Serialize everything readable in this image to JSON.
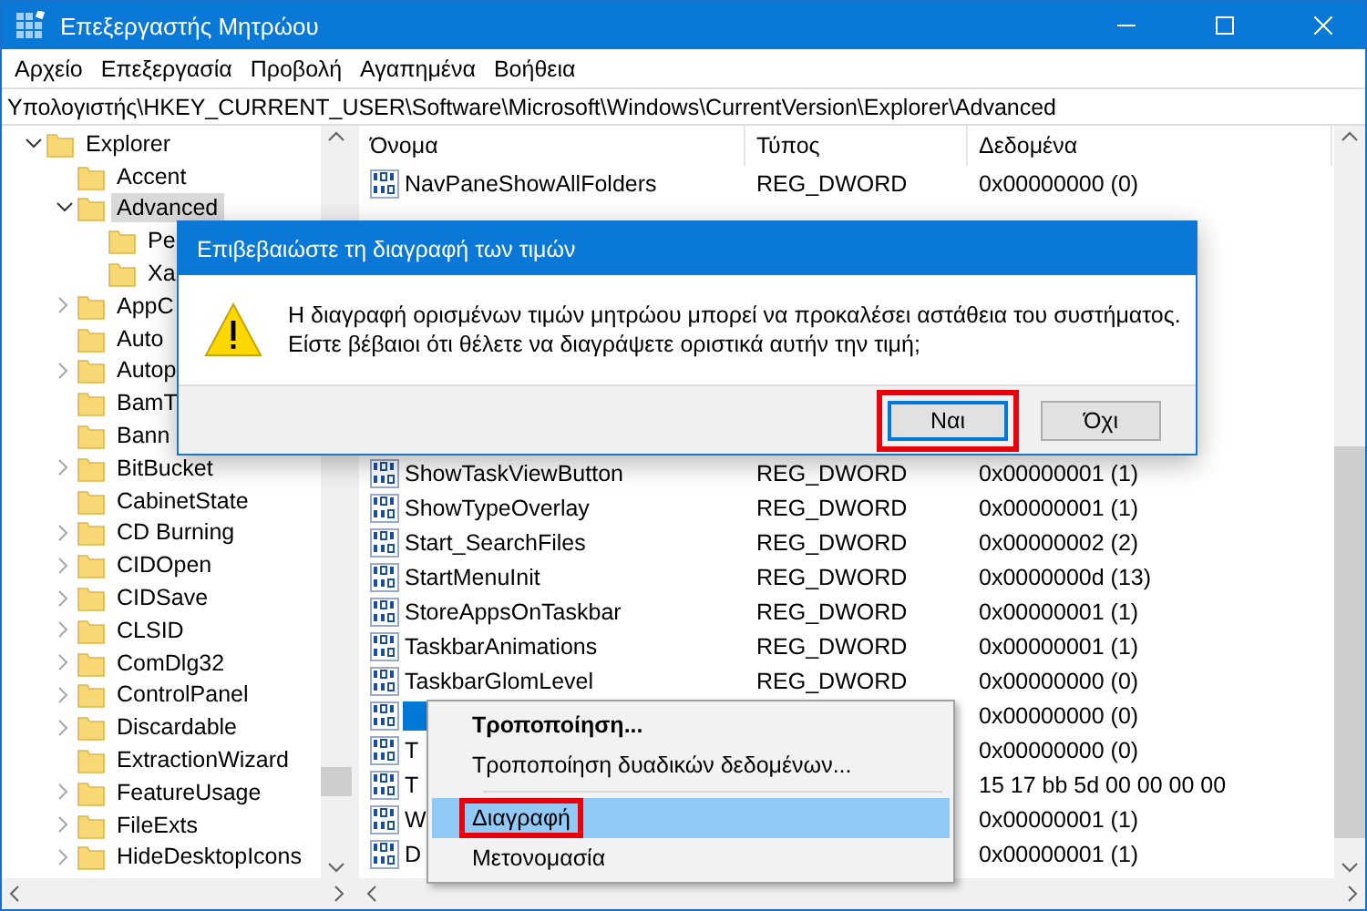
{
  "window": {
    "title": "Επεξεργαστής Μητρώου"
  },
  "menu": [
    "Αρχείο",
    "Επεξεργασία",
    "Προβολή",
    "Αγαπημένα",
    "Βοήθεια"
  ],
  "address": "Υπολογιστής\\HKEY_CURRENT_USER\\Software\\Microsoft\\Windows\\CurrentVersion\\Explorer\\Advanced",
  "tree": [
    {
      "label": "Explorer",
      "expanded": true,
      "selected": false,
      "children": [
        {
          "label": "Accent",
          "expanded": false,
          "selected": false
        },
        {
          "label": "Advanced",
          "expanded": true,
          "selected": true,
          "children": [
            {
              "label": "Pe",
              "expanded": false,
              "selected": false
            },
            {
              "label": "Xa",
              "expanded": false,
              "selected": false
            }
          ]
        },
        {
          "label": "AppC",
          "expandable": true,
          "expanded": false,
          "selected": false
        },
        {
          "label": "Auto",
          "expanded": false,
          "selected": false
        },
        {
          "label": "Autop",
          "expandable": true,
          "expanded": false,
          "selected": false
        },
        {
          "label": "BamT",
          "expanded": false,
          "selected": false
        },
        {
          "label": "Bann",
          "expanded": false,
          "selected": false
        },
        {
          "label": "BitBucket",
          "expandable": true,
          "expanded": false,
          "selected": false
        },
        {
          "label": "CabinetState",
          "expanded": false,
          "selected": false
        },
        {
          "label": "CD Burning",
          "expandable": true,
          "expanded": false,
          "selected": false
        },
        {
          "label": "CIDOpen",
          "expandable": true,
          "expanded": false,
          "selected": false
        },
        {
          "label": "CIDSave",
          "expandable": true,
          "expanded": false,
          "selected": false
        },
        {
          "label": "CLSID",
          "expandable": true,
          "expanded": false,
          "selected": false
        },
        {
          "label": "ComDlg32",
          "expandable": true,
          "expanded": false,
          "selected": false
        },
        {
          "label": "ControlPanel",
          "expandable": true,
          "expanded": false,
          "selected": false
        },
        {
          "label": "Discardable",
          "expandable": true,
          "expanded": false,
          "selected": false
        },
        {
          "label": "ExtractionWizard",
          "expanded": false,
          "selected": false
        },
        {
          "label": "FeatureUsage",
          "expandable": true,
          "expanded": false,
          "selected": false
        },
        {
          "label": "FileExts",
          "expandable": true,
          "expanded": false,
          "selected": false
        },
        {
          "label": "HideDesktopIcons",
          "expandable": true,
          "expanded": false,
          "selected": false
        }
      ]
    }
  ],
  "table": {
    "columns": [
      "Όνομα",
      "Τύπος",
      "Δεδομένα"
    ],
    "rows": [
      {
        "name": "NavPaneShowAllFolders",
        "type": "REG_DWORD",
        "data": "0x00000000 (0)",
        "selected": false
      },
      {
        "name": "ShowTaskViewButton",
        "type": "REG_DWORD",
        "data": "0x00000001 (1)",
        "selected": false,
        "gap_before": true
      },
      {
        "name": "ShowTypeOverlay",
        "type": "REG_DWORD",
        "data": "0x00000001 (1)",
        "selected": false
      },
      {
        "name": "Start_SearchFiles",
        "type": "REG_DWORD",
        "data": "0x00000002 (2)",
        "selected": false
      },
      {
        "name": "StartMenuInit",
        "type": "REG_DWORD",
        "data": "0x0000000d (13)",
        "selected": false
      },
      {
        "name": "StoreAppsOnTaskbar",
        "type": "REG_DWORD",
        "data": "0x00000001 (1)",
        "selected": false
      },
      {
        "name": "TaskbarAnimations",
        "type": "REG_DWORD",
        "data": "0x00000001 (1)",
        "selected": false
      },
      {
        "name": "TaskbarGlomLevel",
        "type": "REG_DWORD",
        "data": "0x00000000 (0)",
        "selected": false
      },
      {
        "data": "0x00000000 (0)",
        "selected": true
      },
      {
        "name": "T",
        "data": "0x00000000 (0)",
        "selected": false
      },
      {
        "name": "T",
        "data": "15 17 bb 5d 00 00 00 00",
        "selected": false
      },
      {
        "name": "W",
        "data": "0x00000001 (1)",
        "selected": false
      },
      {
        "name": "D",
        "data": "0x00000001 (1)",
        "selected": false
      }
    ]
  },
  "dialog": {
    "title": "Επιβεβαιώστε τη διαγραφή των τιμών",
    "message": [
      "Η διαγραφή ορισμένων τιμών μητρώου μπορεί να προκαλέσει αστάθεια του συστήματος.",
      "Είστε βέβαιοι ότι θέλετε να διαγράψετε οριστικά αυτήν την τιμή;"
    ],
    "buttons": [
      {
        "label": "Ναι",
        "default": true,
        "annotated": true
      },
      {
        "label": "Όχι",
        "default": false,
        "annotated": false
      }
    ]
  },
  "context_menu": [
    {
      "label": "Τροποποίηση...",
      "kind": "item",
      "bold": true,
      "selected": false,
      "annotated": false
    },
    {
      "label": "Τροποποίηση δυαδικών δεδομένων...",
      "kind": "item",
      "bold": false,
      "selected": false,
      "annotated": false
    },
    {
      "kind": "separator"
    },
    {
      "label": "Διαγραφή",
      "kind": "item",
      "bold": false,
      "selected": true,
      "annotated": true
    },
    {
      "label": "Μετονομασία",
      "kind": "item",
      "bold": false,
      "selected": false,
      "annotated": false
    }
  ]
}
